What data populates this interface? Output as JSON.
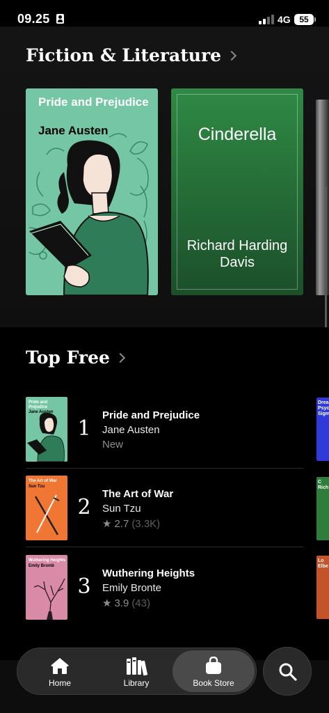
{
  "status_bar": {
    "time": "09.25",
    "network": "4G",
    "battery": "55"
  },
  "sections": {
    "fiction": {
      "title": "Fiction & Literature",
      "books": [
        {
          "title": "Pride and Prejudice",
          "author": "Jane Austen",
          "cover_color": "#74c6a4"
        },
        {
          "title": "Cinderella",
          "author": "Richard Harding Davis",
          "cover_color": "#2f8a44"
        }
      ]
    },
    "top_free": {
      "title": "Top Free",
      "items": [
        {
          "rank": "1",
          "title": "Pride and Prejudice",
          "author": "Jane Austen",
          "meta": "New",
          "thumb_title": "Pride and Prejudice",
          "thumb_author": "Jane Austen",
          "cover_color": "#74c6a4"
        },
        {
          "rank": "2",
          "title": "The Art of War",
          "author": "Sun Tzu",
          "rating": "2.7",
          "count": "(3.3K)",
          "thumb_title": "The Art of War",
          "thumb_author": "Sun Tzu",
          "cover_color": "#f07634"
        },
        {
          "rank": "3",
          "title": "Wuthering Heights",
          "author": "Emily Bronte",
          "rating": "3.9",
          "count": "(43)",
          "thumb_title": "Wuthering Heights",
          "thumb_author": "Emily Brontë",
          "cover_color": "#d98aa6"
        }
      ],
      "peek_column": [
        {
          "text": "Drea Psyc Sigm",
          "color": "#2f3ad8"
        },
        {
          "text": "C Rich",
          "color": "#2e7d3a"
        },
        {
          "text": "Lo Elbe",
          "color": "#c5532a"
        }
      ]
    }
  },
  "tab_bar": {
    "tabs": [
      {
        "label": "Home",
        "icon": "home-icon"
      },
      {
        "label": "Library",
        "icon": "library-icon"
      },
      {
        "label": "Book Store",
        "icon": "bag-icon",
        "active": true
      }
    ],
    "search_icon": "search-icon"
  }
}
